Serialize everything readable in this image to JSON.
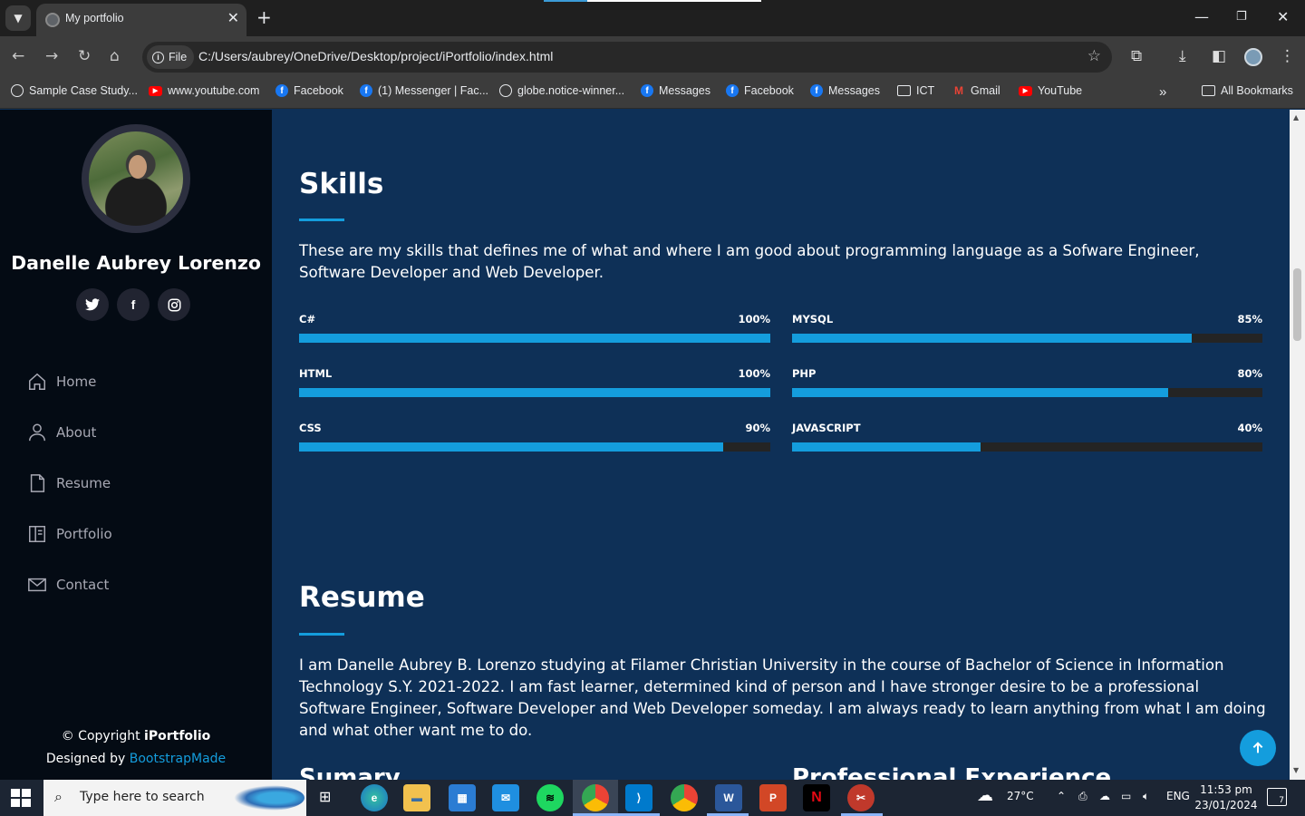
{
  "browser": {
    "tab_title": "My portfolio",
    "url_chip": "File",
    "url": "C:/Users/aubrey/OneDrive/Desktop/project/iPortfolio/index.html",
    "bookmarks": [
      {
        "label": "Sample Case Study...",
        "icon": "globe-icon"
      },
      {
        "label": "www.youtube.com",
        "icon": "youtube-icon"
      },
      {
        "label": "Facebook",
        "icon": "facebook-icon"
      },
      {
        "label": "(1) Messenger | Fac...",
        "icon": "facebook-icon"
      },
      {
        "label": "globe.notice-winner...",
        "icon": "globe-icon"
      },
      {
        "label": "Messages",
        "icon": "facebook-icon"
      },
      {
        "label": "Facebook",
        "icon": "facebook-icon"
      },
      {
        "label": "Messages",
        "icon": "facebook-icon"
      },
      {
        "label": "ICT",
        "icon": "folder-icon"
      },
      {
        "label": "Gmail",
        "icon": "gmail-icon"
      },
      {
        "label": "YouTube",
        "icon": "youtube-icon"
      }
    ],
    "all_bookmarks": "All Bookmarks"
  },
  "sidebar": {
    "name": "Danelle Aubrey Lorenzo",
    "nav": [
      {
        "label": "Home",
        "icon": "home-icon"
      },
      {
        "label": "About",
        "icon": "person-icon"
      },
      {
        "label": "Resume",
        "icon": "file-icon"
      },
      {
        "label": "Portfolio",
        "icon": "book-icon"
      },
      {
        "label": "Contact",
        "icon": "envelope-icon"
      }
    ],
    "footer": {
      "copyright": "© Copyright",
      "brand": "iPortfolio",
      "designed_by": "Designed by",
      "designer": "BootstrapMade"
    }
  },
  "skills": {
    "title": "Skills",
    "description": "These are my skills that defines me of what and where I am good about programming language as a Sofware Engineer, Software Developer and Web Developer.",
    "items": [
      {
        "name": "C#",
        "percent_label": "100%",
        "value": 100
      },
      {
        "name": "MYSQL",
        "percent_label": "85%",
        "value": 85
      },
      {
        "name": "HTML",
        "percent_label": "100%",
        "value": 100
      },
      {
        "name": "PHP",
        "percent_label": "80%",
        "value": 80
      },
      {
        "name": "CSS",
        "percent_label": "90%",
        "value": 90
      },
      {
        "name": "JAVASCRIPT",
        "percent_label": "40%",
        "value": 40
      }
    ]
  },
  "resume": {
    "title": "Resume",
    "description": "I am Danelle Aubrey B. Lorenzo studying at Filamer Christian University in the course of Bachelor of Science in Information Technology S.Y. 2021-2022. I am fast learner, determined kind of person and I have stronger desire to be a professional Software Engineer, Software Developer and Web Developer someday. I am always ready to learn anything from what I am doing and what other want me to do.",
    "summary_title": "Sumary",
    "experience_title": "Professional Experience"
  },
  "taskbar": {
    "search_placeholder": "Type here to search",
    "weather": "27°C",
    "language": "ENG",
    "time": "11:53 pm",
    "date": "23/01/2024",
    "notification_count": "7"
  },
  "colors": {
    "accent": "#149ddd",
    "sidebar_bg": "#040b14",
    "main_bg": "#0e3057",
    "track": "#242424"
  }
}
